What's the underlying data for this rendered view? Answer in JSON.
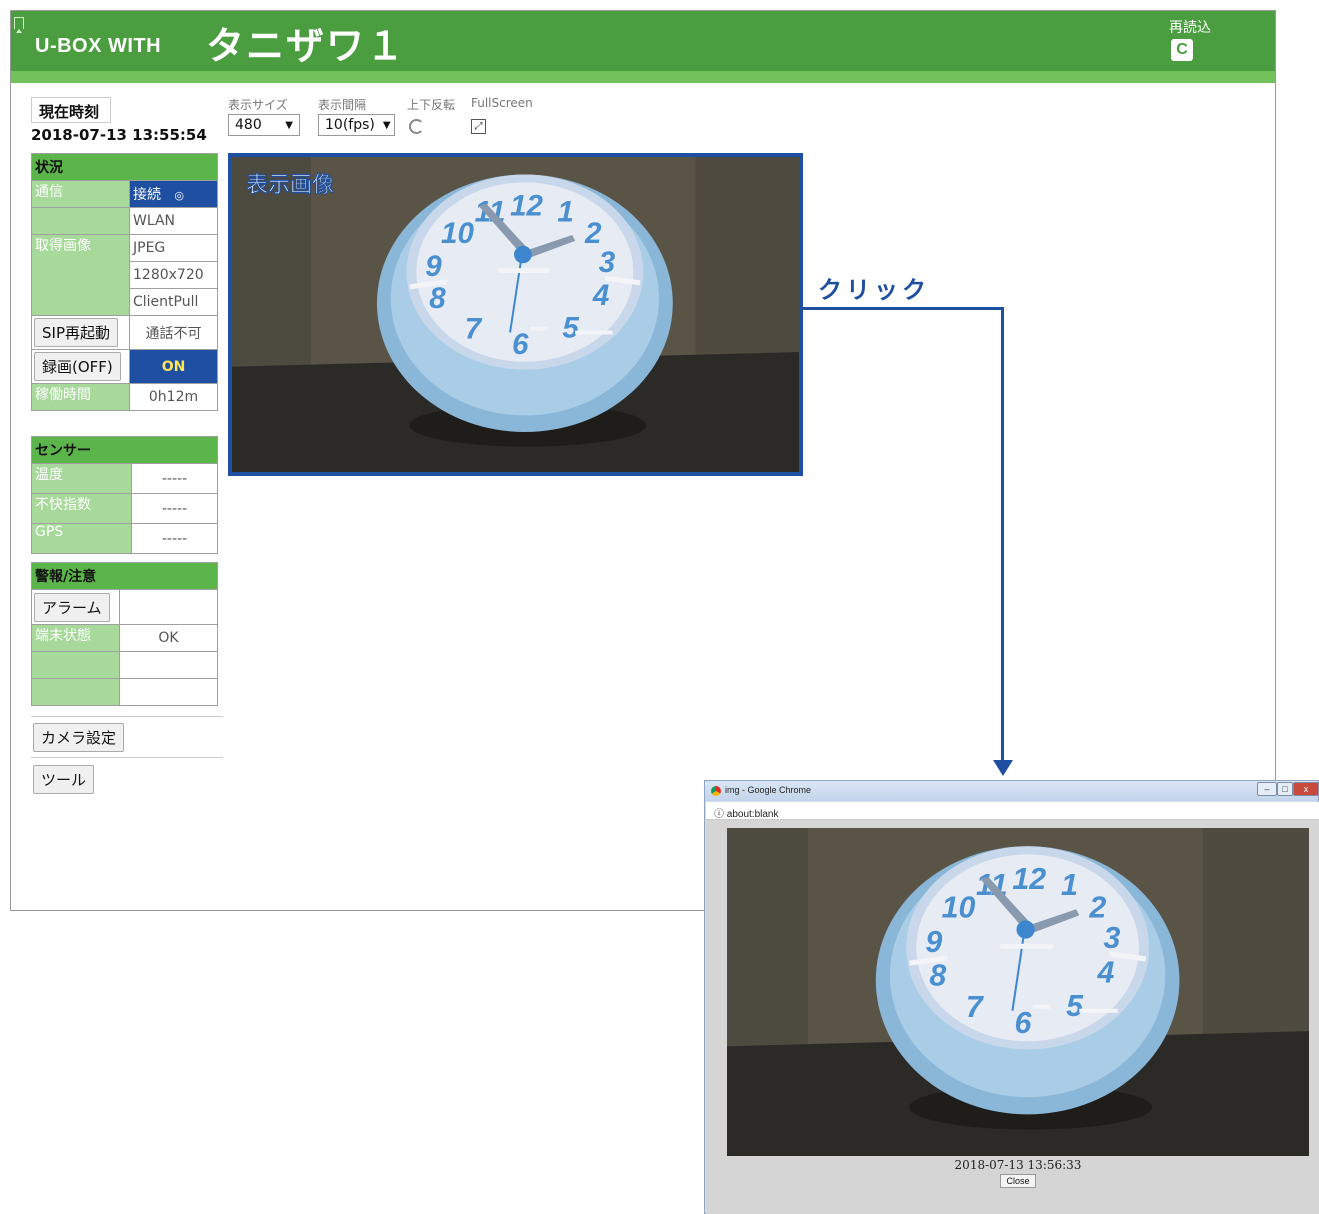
{
  "header": {
    "brand": "U-BOX WITH",
    "station_name": "タニザワ１",
    "reload_label": "再読込",
    "reload_icon": "reload-icon",
    "colors": {
      "header_green": "#4a9e3f",
      "strip_green": "#72c15a",
      "accent_blue": "#1e4fa0"
    }
  },
  "clock": {
    "label": "現在時刻",
    "value": "2018-07-13 13:55:54"
  },
  "status": {
    "title": "状況",
    "comm_label": "通信",
    "comm_value": "接続",
    "comm_icon": "◎",
    "comm_type": "WLAN",
    "image_label": "取得画像",
    "image_format": "JPEG",
    "image_resolution": "1280x720",
    "image_mode": "ClientPull",
    "sip_button": "SIP再起動",
    "sip_status": "通話不可",
    "record_button": "録画(OFF)",
    "record_status": "ON",
    "uptime_label": "稼働時間",
    "uptime_value": "0h12m"
  },
  "sensor": {
    "title": "センサー",
    "rows": [
      {
        "label": "温度",
        "value": "-----"
      },
      {
        "label": "不快指数",
        "value": "-----"
      },
      {
        "label": "GPS",
        "value": "-----"
      }
    ]
  },
  "alert": {
    "title": "警報/注意",
    "alarm_button": "アラーム",
    "terminal_label": "端末状態",
    "terminal_value": "OK"
  },
  "nav": {
    "camera_settings": "カメラ設定",
    "tools": "ツール"
  },
  "controls": {
    "size_label": "表示サイズ",
    "size_value": "480",
    "interval_label": "表示間隔",
    "interval_value": "10(fps)",
    "flip_label": "上下反転",
    "fullscreen_label": "FullScreen"
  },
  "view": {
    "label": "表示画像"
  },
  "annotation": {
    "click_label": "クリック"
  },
  "popup": {
    "window_title": "img - Google Chrome",
    "url": "about:blank",
    "timestamp": "2018-07-13 13:56:33",
    "close_button": "Close",
    "win_controls": [
      "–",
      "□",
      "x"
    ]
  }
}
